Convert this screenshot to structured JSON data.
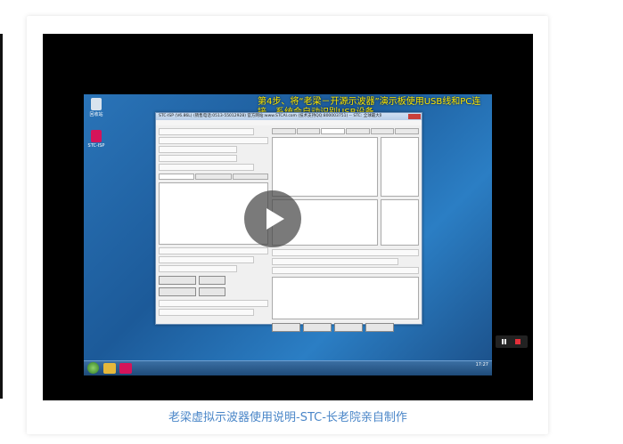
{
  "video": {
    "overlay_title": "第4步、将“老梁－开源示波器”演示板使用USB线和PC连接，系统会自动识别USB设备",
    "desktop_icons": [
      {
        "label": "回收站",
        "icon": "recycle-bin-icon"
      },
      {
        "label": "STC-ISP",
        "icon": "stc-isp-icon"
      }
    ],
    "app_window_title": "STC-ISP (V6.86L) (销售电话:0513-55012928) 官方网站:www.STCAI.com (技术支持QQ:800003751) -- STC: 全球最大的8051单片机设计公司",
    "taskbar_clock": "17:27",
    "controls": {
      "play_icon": "play-icon",
      "pause_icon": "pause-icon",
      "stop_icon": "stop-icon"
    }
  },
  "caption": "老梁虚拟示波器使用说明-STC-长老院亲自制作"
}
